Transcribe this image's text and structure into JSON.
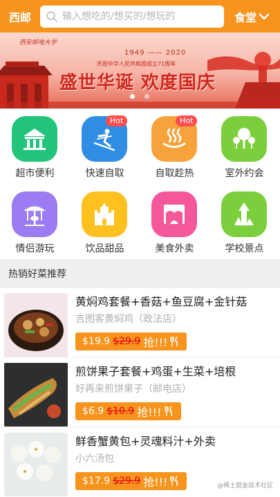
{
  "header": {
    "city": "西邮",
    "search_placeholder": "输入想吃的/想买的/想玩的",
    "canteen": "食堂"
  },
  "banner": {
    "logo_text": "西安邮电大学",
    "years": "1949 —— 2020",
    "subtitle": "庆祝中华人民共和国成立71周年",
    "title": "盛世华诞 欢度国庆"
  },
  "categories": [
    {
      "label": "超市便利",
      "icon": "pavilion-icon",
      "color": "#21c47a"
    },
    {
      "label": "快速自取",
      "icon": "skier-icon",
      "color": "#2f8de4",
      "badge": "Hot"
    },
    {
      "label": "自取趁热",
      "icon": "hot-spring-icon",
      "color": "#f7a33c",
      "badge": "Hot"
    },
    {
      "label": "室外约会",
      "icon": "trees-icon",
      "color": "#7ccf3c"
    },
    {
      "label": "情侣游玩",
      "icon": "carousel-icon",
      "color": "#9b7cf2"
    },
    {
      "label": "饮品甜品",
      "icon": "castle-icon",
      "color": "#ffc11f"
    },
    {
      "label": "美食外卖",
      "icon": "tent-icon",
      "color": "#f5579b"
    },
    {
      "label": "学校景点",
      "icon": "landmark-icon",
      "color": "#7ccf3c"
    }
  ],
  "section_title": "热销好菜推荐",
  "dishes": [
    {
      "title": "黄焖鸡套餐+香菇+鱼豆腐+金针菇",
      "shop": "吉图客黄焖鸡（政法店）",
      "price": "$19.9",
      "old_price": "$29.9",
      "grab": "抢!!!"
    },
    {
      "title": "煎饼果子套餐+鸡蛋+生菜+培根",
      "shop": "好再来煎饼果子（邮电店）",
      "price": "$6.9",
      "old_price": "$10.9",
      "grab": "抢!!!"
    },
    {
      "title": "鲜香蟹黄包+灵魂料汁+外卖",
      "shop": "小六汤包",
      "price": "$17.9",
      "old_price": "$29.9",
      "grab": "抢!!!"
    }
  ],
  "watermark": "@稀土掘金技术社区"
}
